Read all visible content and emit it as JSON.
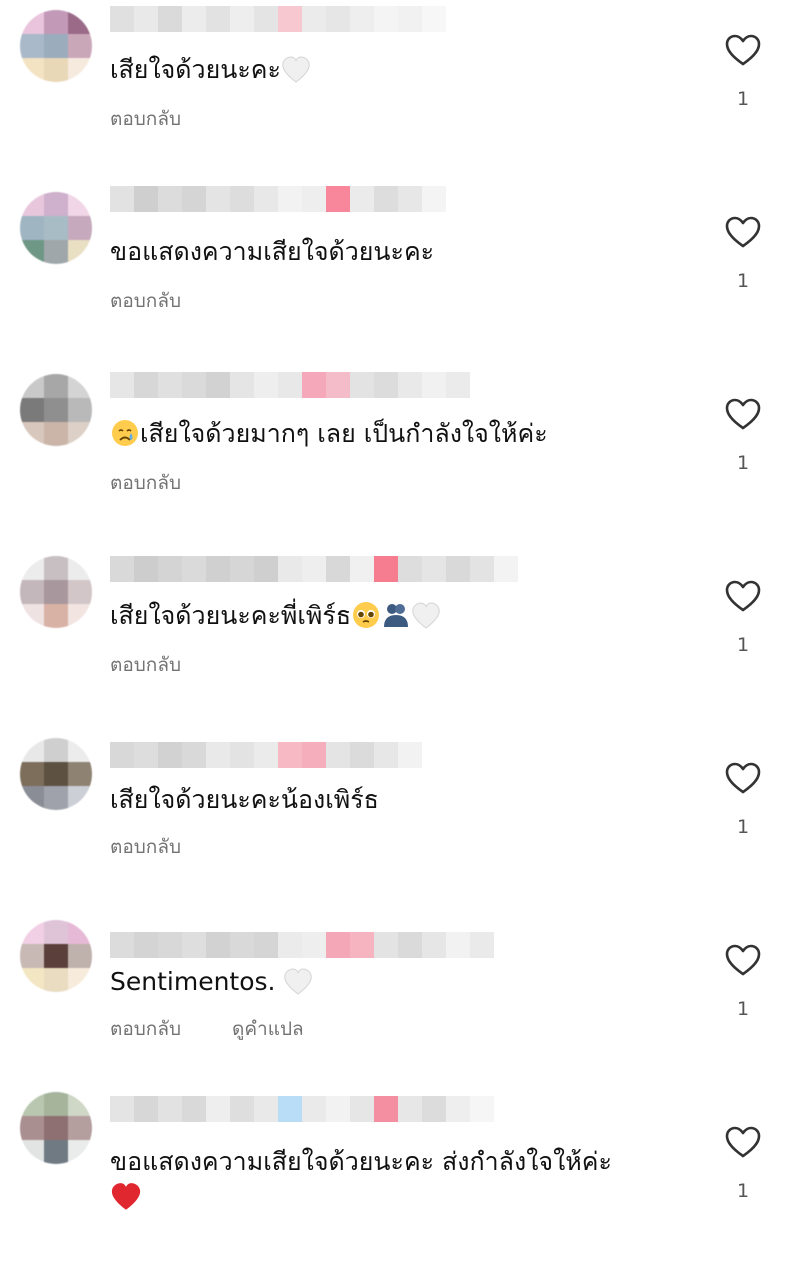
{
  "comments": [
    {
      "text": "เสียใจด้วยนะคะ",
      "reply_label": "ตอบกลับ",
      "likes": "1"
    },
    {
      "text": "ขอแสดงความเสียใจด้วยนะคะ",
      "reply_label": "ตอบกลับ",
      "likes": "1"
    },
    {
      "text_before": "",
      "text": "เสียใจด้วยมากๆ เลย เป็นกำลังใจให้ค่ะ",
      "reply_label": "ตอบกลับ",
      "likes": "1"
    },
    {
      "text": "เสียใจด้วยนะคะพี่เพิร์ธ",
      "reply_label": "ตอบกลับ",
      "likes": "1"
    },
    {
      "text": "เสียใจด้วยนะคะน้องเพิร์ธ",
      "reply_label": "ตอบกลับ",
      "likes": "1"
    },
    {
      "text": "Sentimentos.",
      "reply_label": "ตอบกลับ",
      "translate_label": "ดูคำแปล",
      "likes": "1"
    },
    {
      "text": "ขอแสดงความเสียใจด้วยนะคะ ส่งกำลังใจให้ค่ะ",
      "reply_label": "ตอบกลับ",
      "likes": "1"
    }
  ],
  "icons": {
    "like": "heart-outline-icon",
    "white_heart": "white-heart-emoji",
    "red_heart": "red-heart-emoji",
    "crying": "crying-face-emoji",
    "pleading": "pleading-face-emoji",
    "hug": "people-hugging-emoji"
  },
  "colors": {
    "secondary_text": "#737373",
    "red_heart": "#e0262f"
  }
}
